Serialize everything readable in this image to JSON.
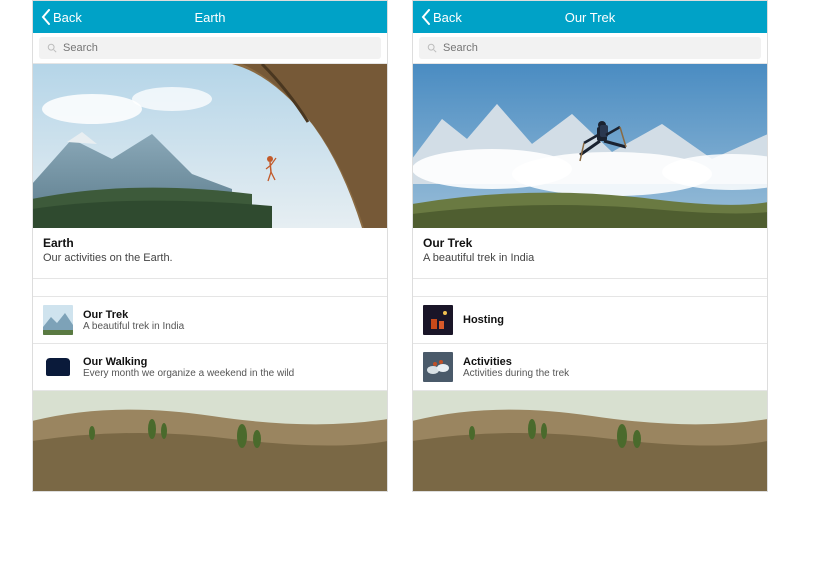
{
  "screens": [
    {
      "nav": {
        "back": "Back",
        "title": "Earth"
      },
      "search": {
        "placeholder": "Search"
      },
      "headline": {
        "title": "Earth",
        "subtitle": "Our activities on the Earth."
      },
      "rows": [
        {
          "title": "Our Trek",
          "subtitle": "A beautiful trek in India"
        },
        {
          "title": "Our Walking",
          "subtitle": "Every month we organize a weekend in the wild"
        }
      ]
    },
    {
      "nav": {
        "back": "Back",
        "title": "Our Trek"
      },
      "search": {
        "placeholder": "Search"
      },
      "headline": {
        "title": "Our Trek",
        "subtitle": "A beautiful trek in India"
      },
      "rows": [
        {
          "title": "Hosting",
          "subtitle": ""
        },
        {
          "title": "Activities",
          "subtitle": "Activities during the trek"
        }
      ]
    }
  ]
}
